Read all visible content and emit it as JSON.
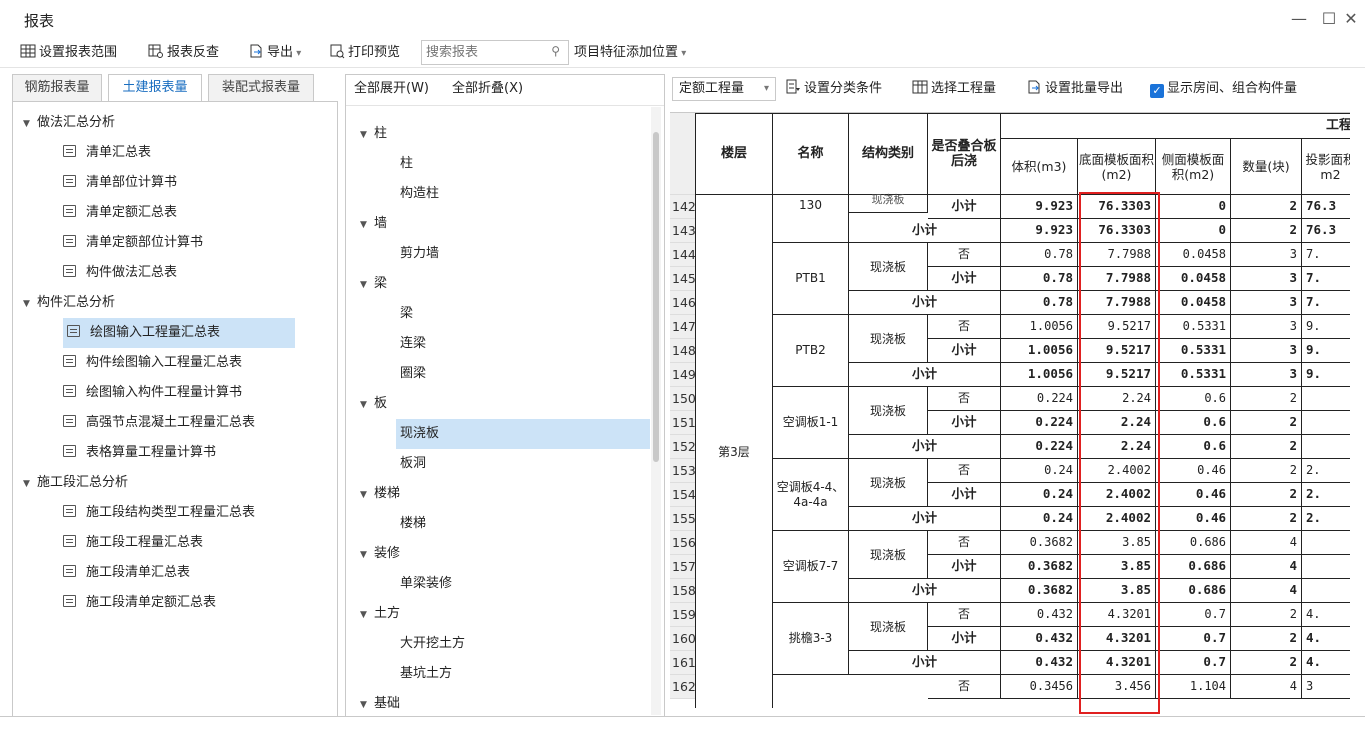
{
  "window": {
    "title": "报表",
    "min": "—",
    "max": "☐",
    "close": "✕"
  },
  "toolbar": {
    "set_range": "设置报表范围",
    "report_check": "报表反查",
    "export": "导出",
    "print_preview": "打印预览",
    "search_placeholder": "搜索报表",
    "feature_position": "项目特征添加位置"
  },
  "tabs": [
    "钢筋报表量",
    "土建报表量",
    "装配式报表量"
  ],
  "left_tree": [
    {
      "label": "做法汇总分析",
      "group": true
    },
    {
      "label": "清单汇总表"
    },
    {
      "label": "清单部位计算书"
    },
    {
      "label": "清单定额汇总表"
    },
    {
      "label": "清单定额部位计算书"
    },
    {
      "label": "构件做法汇总表"
    },
    {
      "label": "构件汇总分析",
      "group": true
    },
    {
      "label": "绘图输入工程量汇总表",
      "selected": true
    },
    {
      "label": "构件绘图输入工程量汇总表"
    },
    {
      "label": "绘图输入构件工程量计算书"
    },
    {
      "label": "高强节点混凝土工程量汇总表"
    },
    {
      "label": "表格算量工程量计算书"
    },
    {
      "label": "施工段汇总分析",
      "group": true
    },
    {
      "label": "施工段结构类型工程量汇总表"
    },
    {
      "label": "施工段工程量汇总表"
    },
    {
      "label": "施工段清单汇总表"
    },
    {
      "label": "施工段清单定额汇总表"
    }
  ],
  "mid_toolbar": {
    "expand_all": "全部展开(W)",
    "collapse_all": "全部折叠(X)"
  },
  "mid_tree": [
    {
      "label": "柱",
      "group": true
    },
    {
      "label": "柱"
    },
    {
      "label": "构造柱"
    },
    {
      "label": "墙",
      "group": true
    },
    {
      "label": "剪力墙"
    },
    {
      "label": "梁",
      "group": true
    },
    {
      "label": "梁"
    },
    {
      "label": "连梁"
    },
    {
      "label": "圈梁"
    },
    {
      "label": "板",
      "group": true
    },
    {
      "label": "现浇板",
      "selected": true
    },
    {
      "label": "板洞"
    },
    {
      "label": "楼梯",
      "group": true
    },
    {
      "label": "楼梯"
    },
    {
      "label": "装修",
      "group": true
    },
    {
      "label": "单梁装修"
    },
    {
      "label": "土方",
      "group": true
    },
    {
      "label": "大开挖土方"
    },
    {
      "label": "基坑土方"
    },
    {
      "label": "基础",
      "group": true
    }
  ],
  "right_toolbar": {
    "quota": "定额工程量",
    "set_category": "设置分类条件",
    "select_quantity": "选择工程量",
    "batch_export": "设置批量导出",
    "show_rooms": "显示房间、组合构件量"
  },
  "table": {
    "group_header": "工程量",
    "headers": [
      "楼层",
      "名称",
      "结构类别",
      "是否叠合板后浇",
      "体积(m3)",
      "底面模板面积(m2)",
      "侧面模板面积(m2)",
      "数量(块)",
      "投影面积m2"
    ],
    "floor": "第3层",
    "row_numbers": [
      "142",
      "143",
      "144",
      "145",
      "146",
      "147",
      "148",
      "149",
      "150",
      "151",
      "152",
      "153",
      "154",
      "155",
      "156",
      "157",
      "158",
      "159",
      "160",
      "161",
      "162"
    ],
    "rows": [
      {
        "name": "130",
        "type": "现浇板",
        "flag": "小计",
        "v": "9.923",
        "bottom": "76.3303",
        "side": "0",
        "qty": "2",
        "proj": "76.3",
        "bold": true
      },
      {
        "name": "",
        "type": "",
        "flag": "小计",
        "v": "9.923",
        "bottom": "76.3303",
        "side": "0",
        "qty": "2",
        "proj": "76.3",
        "bold": true,
        "subtotal": true
      },
      {
        "name": "PTB1",
        "type": "现浇板",
        "flag": "否",
        "v": "0.78",
        "bottom": "7.7988",
        "side": "0.0458",
        "qty": "3",
        "proj": "7.",
        "bold": false
      },
      {
        "name": "",
        "type": "",
        "flag": "小计",
        "v": "0.78",
        "bottom": "7.7988",
        "side": "0.0458",
        "qty": "3",
        "proj": "7.",
        "bold": true
      },
      {
        "name": "",
        "type": "",
        "flag": "小计",
        "v": "0.78",
        "bottom": "7.7988",
        "side": "0.0458",
        "qty": "3",
        "proj": "7.",
        "bold": true,
        "subtotal": true
      },
      {
        "name": "PTB2",
        "type": "现浇板",
        "flag": "否",
        "v": "1.0056",
        "bottom": "9.5217",
        "side": "0.5331",
        "qty": "3",
        "proj": "9.",
        "bold": false
      },
      {
        "name": "",
        "type": "",
        "flag": "小计",
        "v": "1.0056",
        "bottom": "9.5217",
        "side": "0.5331",
        "qty": "3",
        "proj": "9.",
        "bold": true
      },
      {
        "name": "",
        "type": "",
        "flag": "小计",
        "v": "1.0056",
        "bottom": "9.5217",
        "side": "0.5331",
        "qty": "3",
        "proj": "9.",
        "bold": true,
        "subtotal": true
      },
      {
        "name": "空调板1-1",
        "type": "现浇板",
        "flag": "否",
        "v": "0.224",
        "bottom": "2.24",
        "side": "0.6",
        "qty": "2",
        "proj": "",
        "bold": false
      },
      {
        "name": "",
        "type": "",
        "flag": "小计",
        "v": "0.224",
        "bottom": "2.24",
        "side": "0.6",
        "qty": "2",
        "proj": "",
        "bold": true
      },
      {
        "name": "",
        "type": "",
        "flag": "小计",
        "v": "0.224",
        "bottom": "2.24",
        "side": "0.6",
        "qty": "2",
        "proj": "",
        "bold": true,
        "subtotal": true
      },
      {
        "name": "空调板4-4、4a-4a",
        "type": "现浇板",
        "flag": "否",
        "v": "0.24",
        "bottom": "2.4002",
        "side": "0.46",
        "qty": "2",
        "proj": "2.",
        "bold": false
      },
      {
        "name": "",
        "type": "",
        "flag": "小计",
        "v": "0.24",
        "bottom": "2.4002",
        "side": "0.46",
        "qty": "2",
        "proj": "2.",
        "bold": true
      },
      {
        "name": "",
        "type": "",
        "flag": "小计",
        "v": "0.24",
        "bottom": "2.4002",
        "side": "0.46",
        "qty": "2",
        "proj": "2.",
        "bold": true,
        "subtotal": true
      },
      {
        "name": "空调板7-7",
        "type": "现浇板",
        "flag": "否",
        "v": "0.3682",
        "bottom": "3.85",
        "side": "0.686",
        "qty": "4",
        "proj": "",
        "bold": false
      },
      {
        "name": "",
        "type": "",
        "flag": "小计",
        "v": "0.3682",
        "bottom": "3.85",
        "side": "0.686",
        "qty": "4",
        "proj": "",
        "bold": true
      },
      {
        "name": "",
        "type": "",
        "flag": "小计",
        "v": "0.3682",
        "bottom": "3.85",
        "side": "0.686",
        "qty": "4",
        "proj": "",
        "bold": true,
        "subtotal": true
      },
      {
        "name": "挑檐3-3",
        "type": "现浇板",
        "flag": "否",
        "v": "0.432",
        "bottom": "4.3201",
        "side": "0.7",
        "qty": "2",
        "proj": "4.",
        "bold": false
      },
      {
        "name": "",
        "type": "",
        "flag": "小计",
        "v": "0.432",
        "bottom": "4.3201",
        "side": "0.7",
        "qty": "2",
        "proj": "4.",
        "bold": true
      },
      {
        "name": "",
        "type": "",
        "flag": "小计",
        "v": "0.432",
        "bottom": "4.3201",
        "side": "0.7",
        "qty": "2",
        "proj": "4.",
        "bold": true,
        "subtotal": true
      },
      {
        "name": "",
        "type": "现浇板",
        "flag": "否",
        "v": "0.3456",
        "bottom": "3.456",
        "side": "1.104",
        "qty": "4",
        "proj": "3",
        "bold": false
      }
    ]
  },
  "colors": {
    "highlight_box": "#e02020",
    "selection": "#cce3f7",
    "accent": "#1a73d9"
  }
}
